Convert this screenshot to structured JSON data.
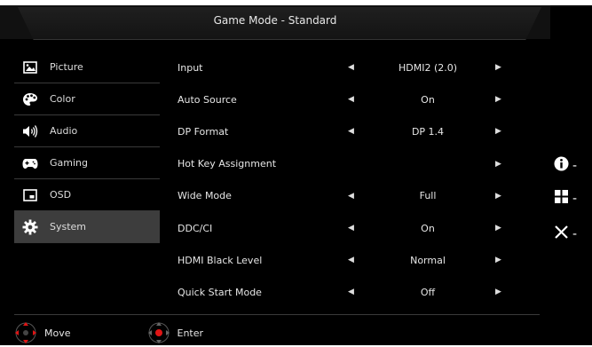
{
  "header": {
    "title": "Game Mode - Standard"
  },
  "sidebar": {
    "items": [
      {
        "label": "Picture",
        "icon": "picture-icon",
        "active": false
      },
      {
        "label": "Color",
        "icon": "palette-icon",
        "active": false
      },
      {
        "label": "Audio",
        "icon": "speaker-icon",
        "active": false
      },
      {
        "label": "Gaming",
        "icon": "gamepad-icon",
        "active": false
      },
      {
        "label": "OSD",
        "icon": "osd-icon",
        "active": false
      },
      {
        "label": "System",
        "icon": "gear-icon",
        "active": true
      }
    ]
  },
  "settings": [
    {
      "label": "Input",
      "value": "HDMI2 (2.0)",
      "left_arrow": true,
      "right_arrow": true
    },
    {
      "label": "Auto Source",
      "value": "On",
      "left_arrow": true,
      "right_arrow": true
    },
    {
      "label": "DP Format",
      "value": "DP 1.4",
      "left_arrow": true,
      "right_arrow": true
    },
    {
      "label": "Hot Key Assignment",
      "value": "",
      "left_arrow": false,
      "right_arrow": true
    },
    {
      "label": "Wide Mode",
      "value": "Full",
      "left_arrow": true,
      "right_arrow": true
    },
    {
      "label": "DDC/CI",
      "value": "On",
      "left_arrow": true,
      "right_arrow": true
    },
    {
      "label": "HDMI Black Level",
      "value": "Normal",
      "left_arrow": true,
      "right_arrow": true
    },
    {
      "label": "Quick Start Mode",
      "value": "Off",
      "left_arrow": true,
      "right_arrow": true
    }
  ],
  "footer": {
    "move_label": "Move",
    "enter_label": "Enter"
  },
  "right_panel": {
    "items": [
      {
        "icon": "info-icon",
        "dash": "-"
      },
      {
        "icon": "menu-grid-icon",
        "dash": "-"
      },
      {
        "icon": "close-icon",
        "dash": "-"
      }
    ]
  },
  "colors": {
    "background": "#000000",
    "active_item": "#3d3d3d",
    "dpad_accent": "#e01515"
  }
}
